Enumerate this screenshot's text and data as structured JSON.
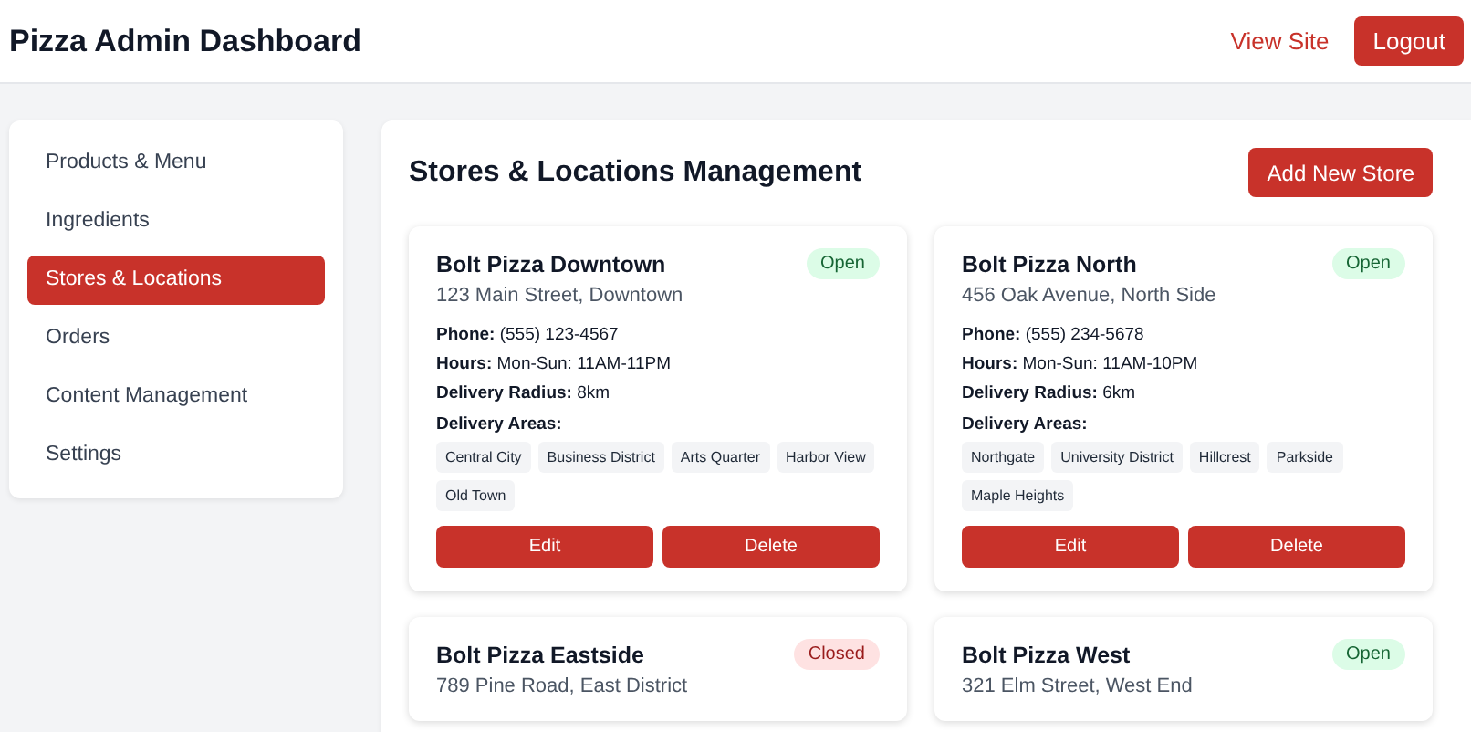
{
  "header": {
    "title": "Pizza Admin Dashboard",
    "links": [
      "View Site"
    ],
    "logout": "Logout"
  },
  "sidebar": {
    "items": [
      {
        "label": "Products & Menu",
        "selected": false
      },
      {
        "label": "Ingredients",
        "selected": false
      },
      {
        "label": "Stores & Locations",
        "selected": true
      },
      {
        "label": "Orders",
        "selected": false
      },
      {
        "label": "Content Management",
        "selected": false
      },
      {
        "label": "Settings",
        "selected": false
      }
    ]
  },
  "main": {
    "title": "Stores & Locations Management",
    "add_button": "Add New Store",
    "stores": [
      {
        "name": "Bolt Pizza Downtown",
        "address": "123 Main Street, Downtown",
        "status": "Open",
        "open": true,
        "details": [
          "**Phone:** (555) 123-4567",
          "**Hours:** Mon-Sun: 11AM-11PM",
          "**Delivery Radius:** 8km"
        ],
        "areas_label": "Delivery Areas:",
        "areas": [
          "Central City",
          "Business District",
          "Arts Quarter",
          "Harbor View",
          "Old Town"
        ],
        "buttons": [
          "Edit",
          "Delete"
        ]
      },
      {
        "name": "Bolt Pizza North",
        "address": "456 Oak Avenue, North Side",
        "status": "Open",
        "open": true,
        "details": [
          "**Phone:** (555) 234-5678",
          "**Hours:** Mon-Sun: 11AM-10PM",
          "**Delivery Radius:** 6km"
        ],
        "areas_label": "Delivery Areas:",
        "areas": [
          "Northgate",
          "University District",
          "Hillcrest",
          "Parkside",
          "Maple Heights"
        ],
        "buttons": [
          "Edit",
          "Delete"
        ]
      },
      {
        "name": "Bolt Pizza Eastside",
        "address": "789 Pine Road, East District",
        "status": "Closed",
        "open": false
      },
      {
        "name": "Bolt Pizza West",
        "address": "321 Elm Street, West End",
        "status": "Open",
        "open": true
      }
    ]
  }
}
